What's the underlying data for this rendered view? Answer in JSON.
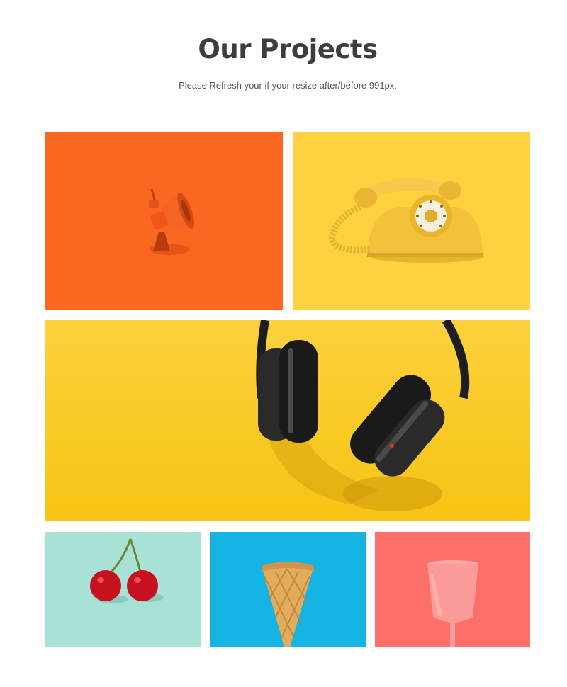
{
  "section": {
    "title": "Our Projects",
    "subtitle": "Please Refresh your if your resize after/before 991px."
  },
  "projects": [
    {
      "subject": "megaphone",
      "background": "#fd6a24"
    },
    {
      "subject": "rotary-telephone",
      "background": "#fdd140"
    },
    {
      "subject": "headphones",
      "background": "#fdcc22"
    },
    {
      "subject": "cherries",
      "background": "#a8e2d6"
    },
    {
      "subject": "waffle-cone",
      "background": "#14b4e4"
    },
    {
      "subject": "pink-cup",
      "background": "#fd7069"
    }
  ]
}
